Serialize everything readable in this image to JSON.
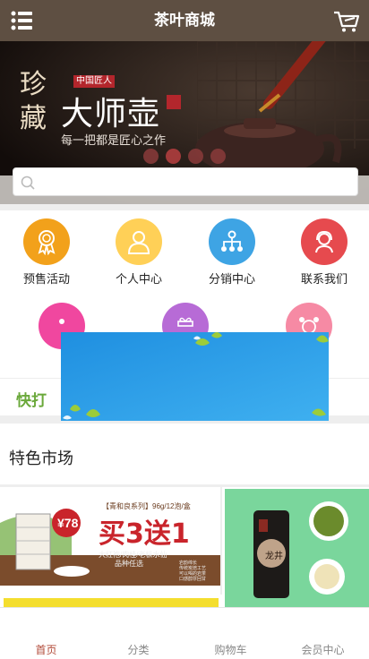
{
  "header": {
    "title": "茶叶商城",
    "menu_icon": "list-menu-icon",
    "cart_icon": "shopping-cart-icon"
  },
  "banner": {
    "vertical_text": "珍藏",
    "badge": "中国匠人",
    "headline": "大师壶",
    "subline": "每一把都是匠心之作",
    "slide_count": 4,
    "active_slide": 1
  },
  "search": {
    "placeholder": "",
    "value": ""
  },
  "grid": [
    {
      "label": "预售活动",
      "icon": "award-ribbon-icon",
      "color": "#f2a11b"
    },
    {
      "label": "个人中心",
      "icon": "user-icon",
      "color": "#ffd057"
    },
    {
      "label": "分销中心",
      "icon": "network-icon",
      "color": "#3ea4e4"
    },
    {
      "label": "联系我们",
      "icon": "support-agent-icon",
      "color": "#e64a4e"
    },
    {
      "label": "",
      "icon": "more-icon",
      "color": "#f0479f"
    },
    {
      "label": "",
      "icon": "gift-icon",
      "color": "#b76bd6"
    },
    {
      "label": "",
      "icon": "alarm-clock-icon",
      "color": "#f68aa4"
    }
  ],
  "quick": {
    "text": "快打"
  },
  "section": {
    "title": "特色市场"
  },
  "promo": {
    "series": "【青和良系列】96g/12泡/盒",
    "price": "¥78",
    "offer": "买3送1",
    "note1": "大红袍/肉桂/老枞水仙",
    "note2": "品种任选",
    "points": [
      "岩韵绵长",
      "传统炭焙工艺",
      "可以喝的岩茶",
      "口感醇厚回甘"
    ]
  },
  "longjing": {
    "label": "龙井"
  },
  "cart_badge": "0",
  "bottom_nav": [
    {
      "label": "首页",
      "active": true
    },
    {
      "label": "分类",
      "active": false
    },
    {
      "label": "购物车",
      "active": false
    },
    {
      "label": "会员中心",
      "active": false
    }
  ]
}
